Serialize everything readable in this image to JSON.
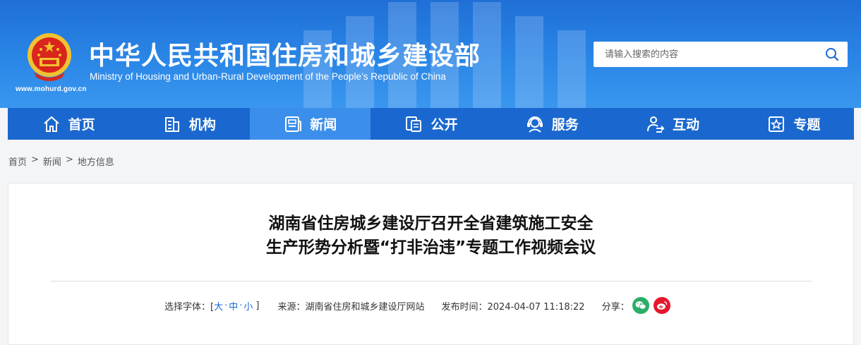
{
  "header": {
    "title_cn": "中华人民共和国住房和城乡建设部",
    "title_en": "Ministry of Housing and Urban-Rural Development of the People’s Republic of China",
    "url": "www.mohurd.gov.cn"
  },
  "search": {
    "placeholder": "请输入搜索的内容"
  },
  "nav": {
    "items": [
      {
        "label": "首页",
        "icon": "home-icon"
      },
      {
        "label": "机构",
        "icon": "building-icon"
      },
      {
        "label": "新闻",
        "icon": "news-icon",
        "active": true
      },
      {
        "label": "公开",
        "icon": "document-icon"
      },
      {
        "label": "服务",
        "icon": "service-icon"
      },
      {
        "label": "互动",
        "icon": "interact-icon"
      },
      {
        "label": "专题",
        "icon": "topic-star-icon"
      }
    ]
  },
  "breadcrumb": {
    "home": "首页",
    "sep1": ">",
    "news": "新闻",
    "sep2": ">",
    "current": "地方信息"
  },
  "article": {
    "title_line1": "湖南省住房城乡建设厅召开全省建筑施工安全",
    "title_line2": "生产形势分析暨“打非治违”专题工作视频会议",
    "font_label": "选择字体：[",
    "size_large": "大",
    "dash1": "·",
    "size_medium": "中",
    "dash2": "·",
    "size_small": "小",
    "font_close": "]",
    "source": "来源：湖南省住房和城乡建设厅网站",
    "publish_time": "发布时间：2024-04-07 11:18:22",
    "share_label": "分享："
  },
  "colors": {
    "brand_blue": "#1a68cf",
    "active_nav": "#3b8fea",
    "wechat_green": "#2aae67",
    "weibo_red": "#e6162d"
  }
}
